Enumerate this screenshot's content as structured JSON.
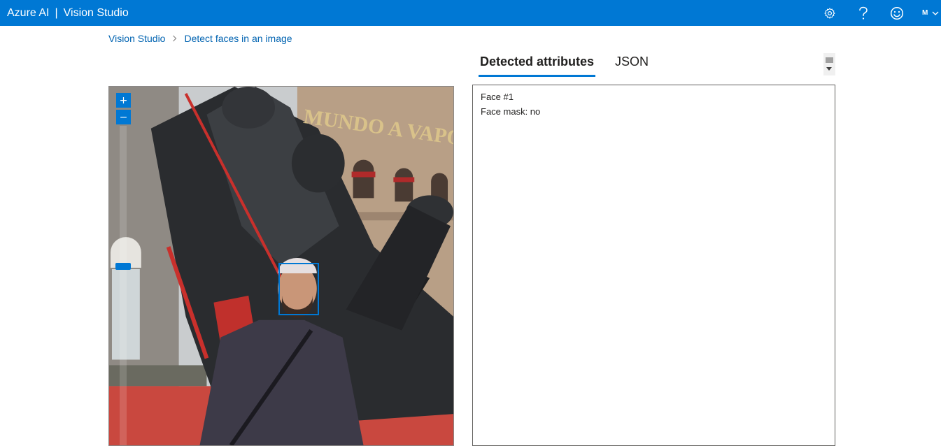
{
  "header": {
    "brand": "Azure AI",
    "separator": "|",
    "product": "Vision Studio",
    "icons": [
      "settings-icon",
      "help-icon",
      "feedback-smiley-icon"
    ],
    "avatar_initial": "M",
    "colors": {
      "bar": "#0078d4",
      "text": "#ffffff"
    }
  },
  "breadcrumb": {
    "items": [
      "Vision Studio",
      "Detect faces in an image"
    ]
  },
  "tabs": [
    {
      "label": "Detected attributes",
      "active": true
    },
    {
      "label": "JSON",
      "active": false
    }
  ],
  "image_viewer": {
    "zoom_in_label": "+",
    "zoom_out_label": "−",
    "sign_text": "MUNDO A VAPOR"
  },
  "results": {
    "face_title": "Face #1",
    "face_mask": "Face mask: no"
  },
  "colors": {
    "accent": "#0078d4",
    "link": "#0063b1"
  }
}
